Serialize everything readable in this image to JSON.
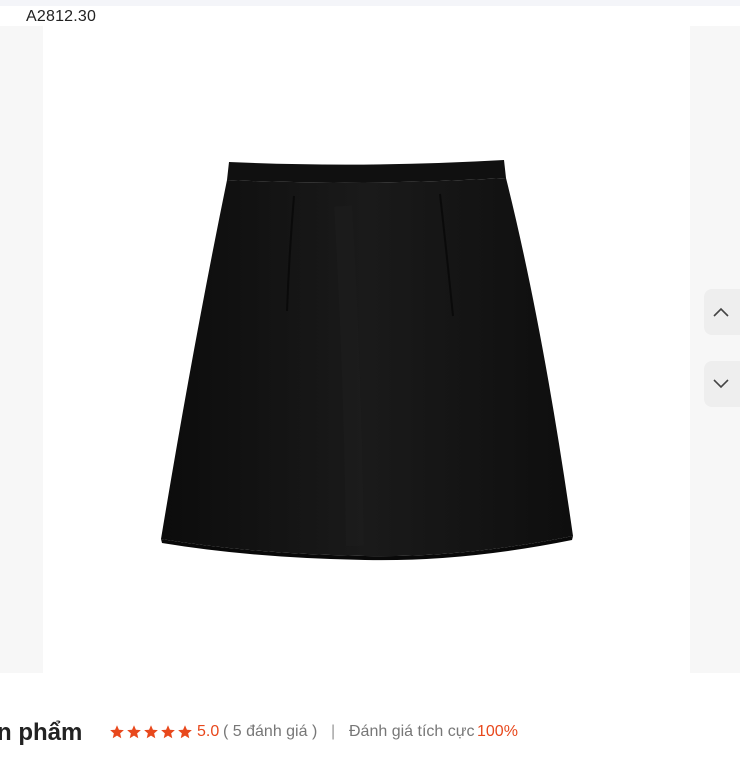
{
  "product": {
    "sku": "A2812.30"
  },
  "gallery": {
    "scroll_up_icon": "chevron-up-icon",
    "scroll_down_icon": "chevron-down-icon"
  },
  "reviews": {
    "section_title": "n phẩm",
    "star_icon": "star-icon",
    "star_count": 5,
    "rating": "5.0",
    "review_count": "( 5 đánh giá )",
    "divider": "|",
    "positive_label": "Đánh giá tích cực",
    "positive_value": "100%"
  },
  "colors": {
    "accent": "#e8481c",
    "skirt": "#141414",
    "side_panel": "#f7f7f7",
    "nav_button": "#eeeeee"
  }
}
